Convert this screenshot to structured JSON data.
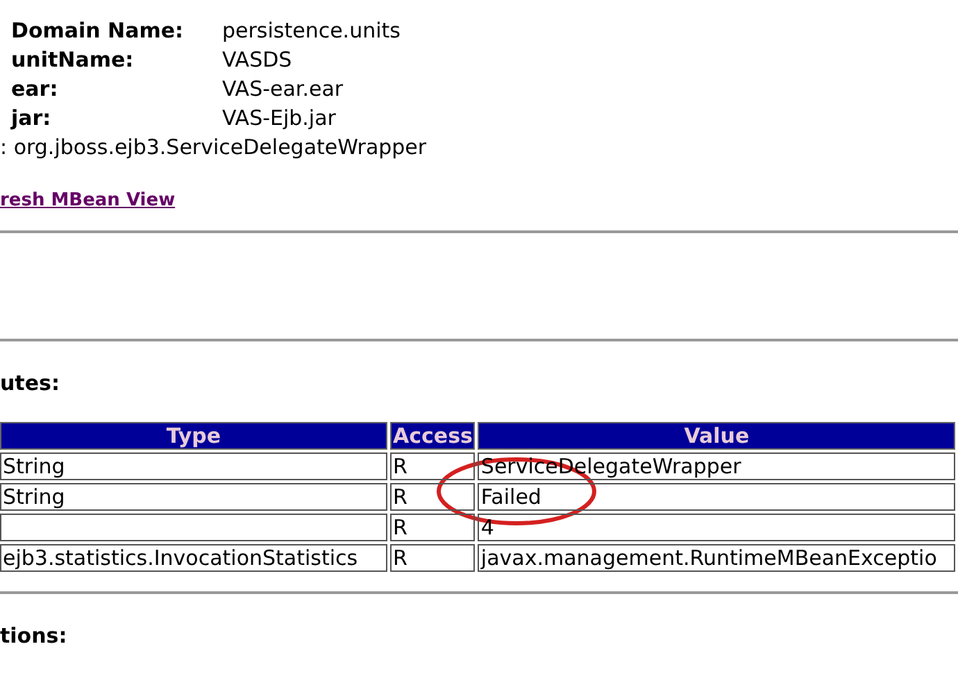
{
  "properties": [
    {
      "label": "Domain Name:",
      "value": "persistence.units"
    },
    {
      "label": "unitName:",
      "value": "VASDS"
    },
    {
      "label": "ear:",
      "value": "VAS-ear.ear"
    },
    {
      "label": "jar:",
      "value": "VAS-Ejb.jar"
    }
  ],
  "class_line": ": org.jboss.ejb3.ServiceDelegateWrapper",
  "refresh_link": "resh MBean View",
  "attributes_heading": "utes:",
  "table": {
    "columns": [
      "Type",
      "Access",
      "Value"
    ],
    "rows": [
      {
        "type": "String",
        "access": "R",
        "value": "ServiceDelegateWrapper"
      },
      {
        "type": "String",
        "access": "R",
        "value": "Failed"
      },
      {
        "access": "R",
        "value": "4"
      },
      {
        "type": "ejb3.statistics.InvocationStatistics",
        "access": "R",
        "value": "javax.management.RuntimeMBeanExceptio"
      }
    ]
  },
  "operations_heading": "tions:"
}
